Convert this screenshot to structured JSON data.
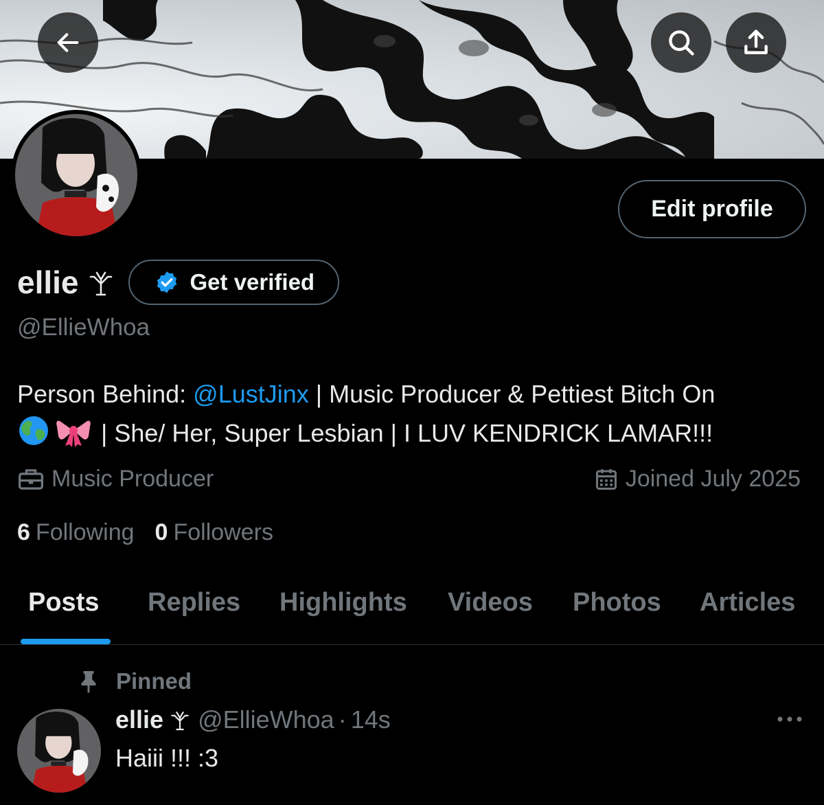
{
  "header": {
    "back_icon": "arrow-left-icon",
    "search_icon": "search-icon",
    "share_icon": "share-icon"
  },
  "profile": {
    "display_name": "ellie",
    "name_glyph": "branch-glyph-icon",
    "verify_label": "Get verified",
    "handle": "@EllieWhoa",
    "edit_label": "Edit profile",
    "bio": {
      "prefix": "Person Behind: ",
      "mention": "@LustJinx",
      "line1_rest": " | Music Producer & Pettiest Bitch On",
      "line2_rest": " | She/ Her, Super Lesbian | I LUV KENDRICK LAMAR!!!"
    },
    "profession": "Music Producer",
    "joined": "Joined July 2025",
    "following_count": "6",
    "following_label": "Following",
    "followers_count": "0",
    "followers_label": "Followers"
  },
  "tabs": [
    {
      "label": "Posts",
      "active": true
    },
    {
      "label": "Replies"
    },
    {
      "label": "Highlights"
    },
    {
      "label": "Videos"
    },
    {
      "label": "Photos"
    },
    {
      "label": "Articles"
    }
  ],
  "post": {
    "pinned_label": "Pinned",
    "name": "ellie",
    "handle": "@EllieWhoa",
    "dot": "·",
    "time": "14s",
    "text": "Haiii !!! :3"
  },
  "colors": {
    "accent": "#1d9bf0",
    "background": "#000000",
    "muted": "#71767b",
    "border": "#536471"
  }
}
